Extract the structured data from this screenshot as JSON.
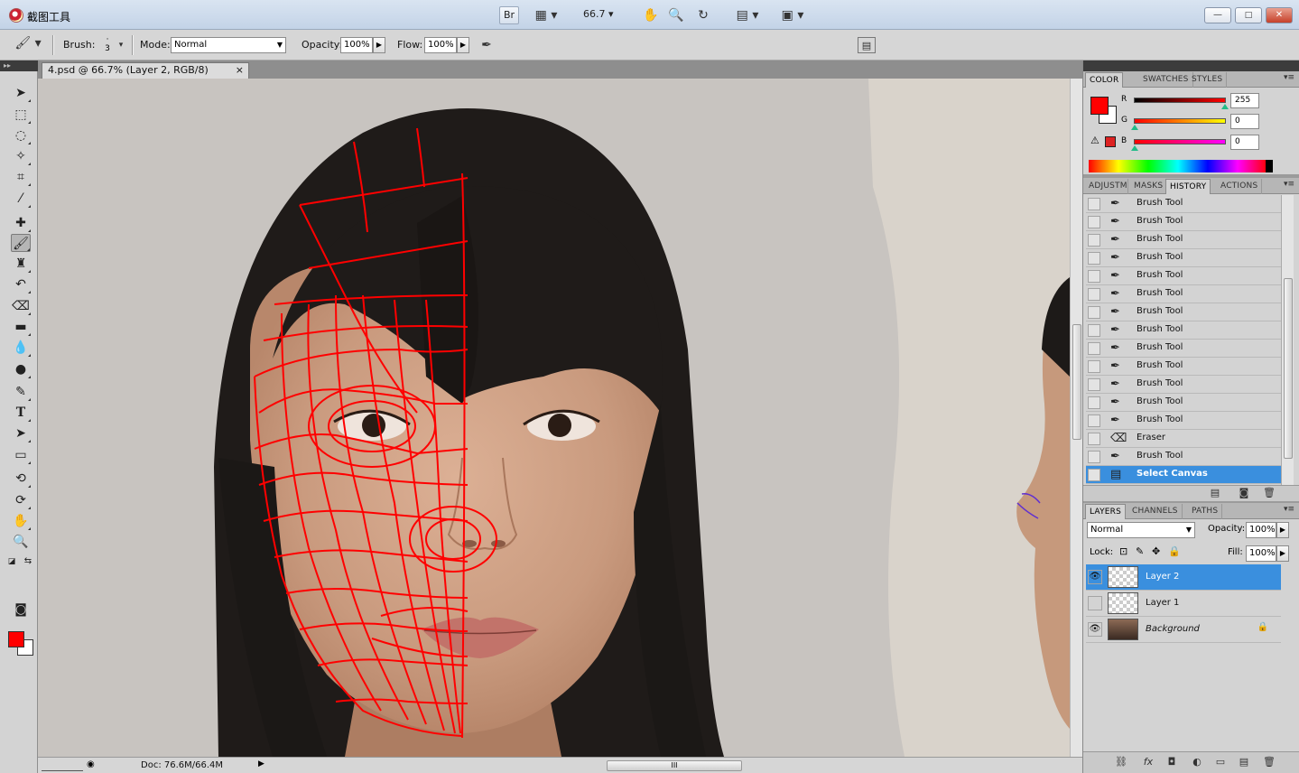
{
  "title": {
    "app_name": "截图工具",
    "bridge_label": "Br",
    "zoom_value": "66.7",
    "window_buttons": {
      "minimize": "—",
      "maximize": "□",
      "close": "✕"
    },
    "restore_button": "🗗"
  },
  "options": {
    "brush_label": "Brush:",
    "brush_size": "3",
    "mode_label": "Mode:",
    "mode_value": "Normal",
    "opacity_label": "Opacity:",
    "opacity_value": "100%",
    "flow_label": "Flow:",
    "flow_value": "100%"
  },
  "document": {
    "tab_title": "4.psd @ 66.7% (Layer 2, RGB/8)",
    "tab_close": "×",
    "status_doc": "Doc: 76.6M/66.4M",
    "scroll_grip": "III"
  },
  "colors": {
    "foreground": "#ff0000",
    "background": "#ffffff",
    "mesh": "#ff0000",
    "selection": "#3a8fde"
  },
  "color_panel": {
    "tabs": [
      "COLOR",
      "SWATCHES",
      "STYLES"
    ],
    "r_label": "R",
    "r_value": "255",
    "g_label": "G",
    "g_value": "0",
    "b_label": "B",
    "b_value": "0"
  },
  "history_panel": {
    "tabs": [
      "ADJUSTM",
      "MASKS",
      "HISTORY",
      "ACTIONS"
    ],
    "items": [
      {
        "label": "Brush Tool",
        "icon": "brush-icon"
      },
      {
        "label": "Brush Tool",
        "icon": "brush-icon"
      },
      {
        "label": "Brush Tool",
        "icon": "brush-icon"
      },
      {
        "label": "Brush Tool",
        "icon": "brush-icon"
      },
      {
        "label": "Brush Tool",
        "icon": "brush-icon"
      },
      {
        "label": "Brush Tool",
        "icon": "brush-icon"
      },
      {
        "label": "Brush Tool",
        "icon": "brush-icon"
      },
      {
        "label": "Brush Tool",
        "icon": "brush-icon"
      },
      {
        "label": "Brush Tool",
        "icon": "brush-icon"
      },
      {
        "label": "Brush Tool",
        "icon": "brush-icon"
      },
      {
        "label": "Brush Tool",
        "icon": "brush-icon"
      },
      {
        "label": "Brush Tool",
        "icon": "brush-icon"
      },
      {
        "label": "Brush Tool",
        "icon": "brush-icon"
      },
      {
        "label": "Eraser",
        "icon": "eraser-icon"
      },
      {
        "label": "Brush Tool",
        "icon": "brush-icon"
      },
      {
        "label": "Select Canvas",
        "icon": "select-canvas-icon"
      }
    ]
  },
  "layers_panel": {
    "tabs": [
      "LAYERS",
      "CHANNELS",
      "PATHS"
    ],
    "blend_mode": "Normal",
    "opacity_label": "Opacity:",
    "opacity_value": "100%",
    "lock_label": "Lock:",
    "fill_label": "Fill:",
    "fill_value": "100%",
    "layers": [
      {
        "name": "Layer 2",
        "visible": true,
        "selected": true
      },
      {
        "name": "Layer 1",
        "visible": false,
        "selected": false
      },
      {
        "name": "Background",
        "visible": true,
        "selected": false,
        "locked": true
      }
    ]
  }
}
